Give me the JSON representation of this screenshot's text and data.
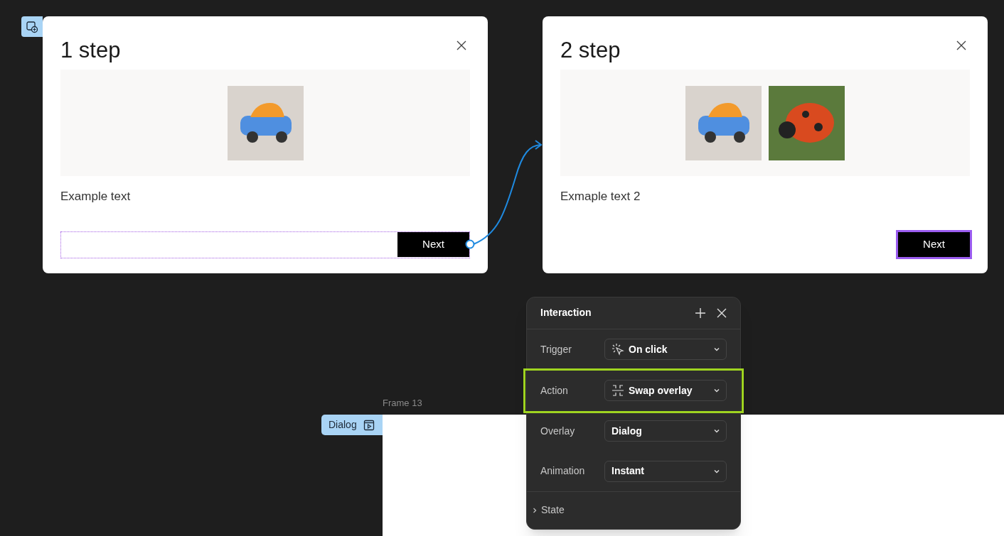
{
  "dialogs": [
    {
      "title": "1 step",
      "images": [
        {
          "kind": "car"
        }
      ],
      "text": "Example text",
      "footer_selected": true,
      "button": {
        "label": "Next",
        "selected": false
      }
    },
    {
      "title": "2 step",
      "images": [
        {
          "kind": "car"
        },
        {
          "kind": "ladybug"
        }
      ],
      "text": "Exmaple text 2",
      "footer_selected": false,
      "button": {
        "label": "Next",
        "selected": true
      }
    }
  ],
  "interaction_panel": {
    "title": "Interaction",
    "rows": [
      {
        "label": "Trigger",
        "value": "On click",
        "highlighted": false
      },
      {
        "label": "Action",
        "value": "Swap overlay",
        "highlighted": true
      },
      {
        "label": "Overlay",
        "value": "Dialog",
        "highlighted": false
      },
      {
        "label": "Animation",
        "value": "Instant",
        "highlighted": false
      }
    ],
    "section": {
      "label": "State",
      "expanded": false
    }
  },
  "frame": {
    "label": "Frame 13",
    "tag": "Dialog"
  }
}
